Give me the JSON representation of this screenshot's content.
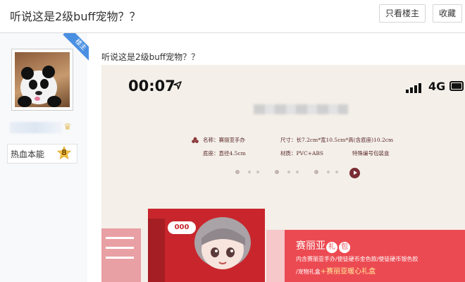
{
  "header": {
    "title": "听说这是2级buff宠物？？",
    "only_author_label": "只看楼主",
    "favorite_label": "收藏"
  },
  "author": {
    "badge": "楼主",
    "rank_title": "热血本能",
    "rank_level": "8"
  },
  "post": {
    "text": "听说这是2级buff宠物？？",
    "image": {
      "status_time": "00:07",
      "network": "4G",
      "specs": {
        "name": "名称：赛丽亚手办",
        "size": "尺寸：长7.2cm*宽10.5cm*高(含底座)10.2cm",
        "base": "底座：直径4.5cm",
        "material": "材质：PVC+ABS",
        "package": "特殊编号包装盒"
      },
      "box_label": "000",
      "gift_title_pre": "赛丽亚",
      "gift_badge_1": "礼",
      "gift_badge_2": "包",
      "gift_line1": "内含赛丽亚手办/使徒硬币金色款/使徒硬币银色款",
      "gift_line2_pre": "/宠物礼盒",
      "gift_line2_hl": "+赛丽亚暖心礼盒"
    }
  },
  "colors": {
    "badge_blue": "#4a90e2",
    "accent_red": "#c8262c",
    "banner_red": "#ec4a52"
  }
}
